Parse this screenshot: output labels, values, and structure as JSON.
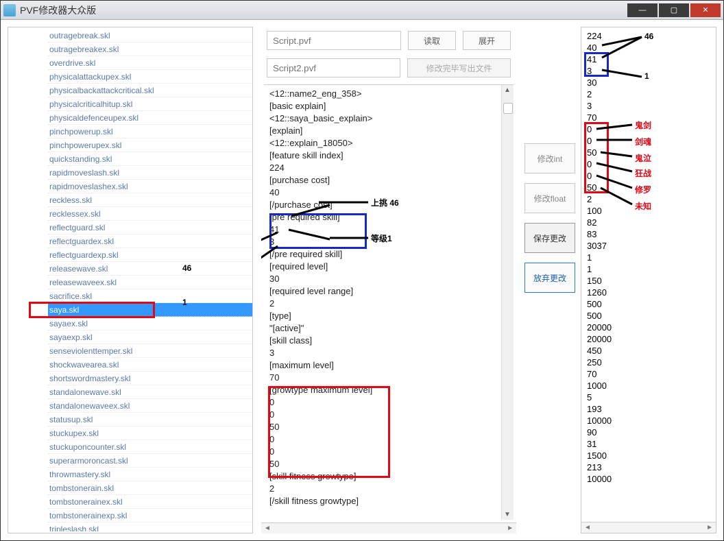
{
  "window": {
    "title": "PVF修改器大众版"
  },
  "file_tree": {
    "items": [
      "outragebreak.skl",
      "outragebreakex.skl",
      "overdrive.skl",
      "physicalattackupex.skl",
      "physicalbackattackcritical.skl",
      "physicalcriticalhitup.skl",
      "physicaldefenceupex.skl",
      "pinchpowerup.skl",
      "pinchpowerupex.skl",
      "quickstanding.skl",
      "rapidmoveslash.skl",
      "rapidmoveslashex.skl",
      "reckless.skl",
      "recklessex.skl",
      "reflectguard.skl",
      "reflectguardex.skl",
      "reflectguardexp.skl",
      "releasewave.skl",
      "releasewaveex.skl",
      "sacrifice.skl",
      "saya.skl",
      "sayaex.skl",
      "sayaexp.skl",
      "senseviolenttemper.skl",
      "shockwavearea.skl",
      "shortswordmastery.skl",
      "standalonewave.skl",
      "standalonewaveex.skl",
      "statusup.skl",
      "stuckupex.skl",
      "stuckuponcounter.skl",
      "superarmoroncast.skl",
      "throwmastery.skl",
      "tombstonerain.skl",
      "tombstonerainex.skl",
      "tombstonerainexp.skl",
      "tripleslash.skl"
    ],
    "selected_index": 20
  },
  "toolbar": {
    "script1_placeholder": "Script.pvf",
    "script2_placeholder": "Script2.pvf",
    "read_label": "读取",
    "expand_label": "展开",
    "write_label": "修改完毕写出文件"
  },
  "editor_lines": [
    "<12::name2_eng_358>",
    "[basic explain]",
    "<12::saya_basic_explain>",
    "[explain]",
    "<12::explain_18050>",
    "[feature skill index]",
    "224",
    "[purchase cost]",
    "40",
    "[/purchase cost]",
    "[pre required skill]",
    "41",
    "3",
    "[/pre required skill]",
    "[required level]",
    "30",
    "[required level range]",
    "2",
    "[type]",
    "\"[active]\"",
    "[skill class]",
    "3",
    "[maximum level]",
    "70",
    "[growtype maximum level]",
    "0",
    "0",
    "50",
    "0",
    "0",
    "50",
    "[skill fitness growtype]",
    "2",
    "[/skill fitness growtype]"
  ],
  "right_buttons": {
    "mod_int": "修改int",
    "mod_float": "修改float",
    "save": "保存更改",
    "discard": "放弃更改"
  },
  "right_values": [
    "224",
    "40",
    "41",
    "3",
    "30",
    "2",
    "3",
    "70",
    "0",
    "0",
    "50",
    "0",
    "0",
    "50",
    "2",
    "100",
    "82",
    "83",
    "3037",
    "1",
    "1",
    "150",
    "1260",
    "500",
    "500",
    "20000",
    "20000",
    "450",
    "250",
    "70",
    "1000",
    "5",
    "193",
    "10000",
    "90",
    "31",
    "1500",
    "213",
    "10000"
  ],
  "annotations": {
    "left_46": "46",
    "left_1": "1",
    "mid_uptiao": "上挑 46",
    "mid_level1": "等级1",
    "right_46": "46",
    "right_1": "1",
    "labels": [
      "鬼剑",
      "剑魂",
      "鬼泣",
      "狂战",
      "修罗",
      "未知"
    ]
  }
}
